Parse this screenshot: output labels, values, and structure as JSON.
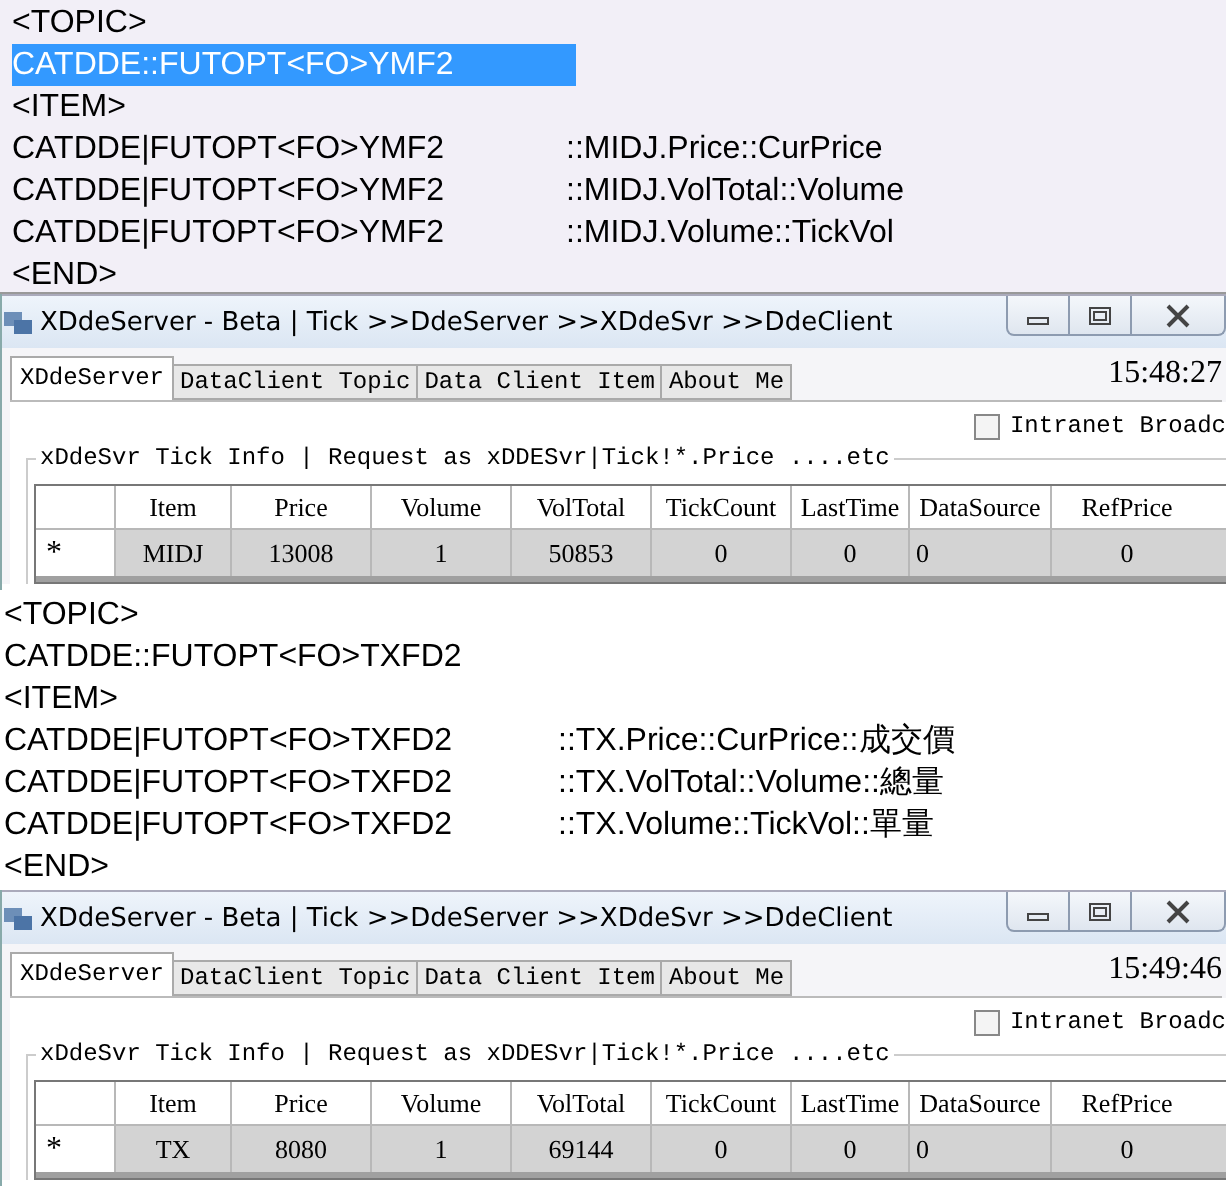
{
  "sections": [
    {
      "kind": "text",
      "lines": [
        {
          "text": "<TOPIC>",
          "selected": false
        },
        {
          "text": "CATDDE::FUTOPT<FO>YMF2",
          "selected": true
        },
        {
          "text": "<ITEM>",
          "selected": false
        },
        {
          "text": "CATDDE|FUTOPT<FO>YMF2",
          "value": "::MIDJ.Price::CurPrice",
          "selected": false
        },
        {
          "text": "CATDDE|FUTOPT<FO>YMF2",
          "value": "::MIDJ.VolTotal::Volume",
          "selected": false
        },
        {
          "text": "CATDDE|FUTOPT<FO>YMF2",
          "value": "::MIDJ.Volume::TickVol",
          "selected": false
        },
        {
          "text": "<END>",
          "selected": false
        }
      ]
    },
    {
      "kind": "window",
      "title": "XDdeServer - Beta | Tick >>DdeServer >>XDdeSvr >>DdeClient",
      "tabs": [
        {
          "label": "XDdeServer",
          "selected": true
        },
        {
          "label": "DataClient Topic",
          "selected": false
        },
        {
          "label": "Data Client Item",
          "selected": false
        },
        {
          "label": "About Me",
          "selected": false
        }
      ],
      "clock": "15:48:27",
      "checkbox": {
        "label": "Intranet Broadc",
        "checked": false
      },
      "group_title": "xDdeSvr Tick Info |  Request as xDDESvr|Tick!*.Price ....etc",
      "columns": [
        "Item",
        "Price",
        "Volume",
        "VolTotal",
        "TickCount",
        "LastTime",
        "DataSource",
        "RefPrice"
      ],
      "rows": [
        {
          "marker": "*",
          "cells": [
            "MIDJ",
            "13008",
            "1",
            "50853",
            "0",
            "0",
            "0",
            "0"
          ]
        }
      ]
    },
    {
      "kind": "text",
      "lines": [
        {
          "text": "<TOPIC>",
          "selected": false
        },
        {
          "text": "CATDDE::FUTOPT<FO>TXFD2",
          "selected": false
        },
        {
          "text": "<ITEM>",
          "selected": false
        },
        {
          "text": "CATDDE|FUTOPT<FO>TXFD2",
          "value": "::TX.Price::CurPrice::成交價",
          "selected": false
        },
        {
          "text": "CATDDE|FUTOPT<FO>TXFD2",
          "value": "::TX.VolTotal::Volume::總量",
          "selected": false
        },
        {
          "text": "CATDDE|FUTOPT<FO>TXFD2",
          "value": "::TX.Volume::TickVol::單量",
          "selected": false
        },
        {
          "text": "<END>",
          "selected": false
        }
      ]
    },
    {
      "kind": "window",
      "title": "XDdeServer - Beta | Tick >>DdeServer >>XDdeSvr >>DdeClient",
      "tabs": [
        {
          "label": "XDdeServer",
          "selected": true
        },
        {
          "label": "DataClient Topic",
          "selected": false
        },
        {
          "label": "Data Client Item",
          "selected": false
        },
        {
          "label": "About Me",
          "selected": false
        }
      ],
      "clock": "15:49:46",
      "checkbox": {
        "label": "Intranet Broadc",
        "checked": false
      },
      "group_title": "xDdeSvr Tick Info |  Request as xDDESvr|Tick!*.Price ....etc",
      "columns": [
        "Item",
        "Price",
        "Volume",
        "VolTotal",
        "TickCount",
        "LastTime",
        "DataSource",
        "RefPrice"
      ],
      "rows": [
        {
          "marker": "*",
          "cells": [
            "TX",
            "8080",
            "1",
            "69144",
            "0",
            "0",
            "0",
            "0"
          ]
        }
      ]
    }
  ]
}
